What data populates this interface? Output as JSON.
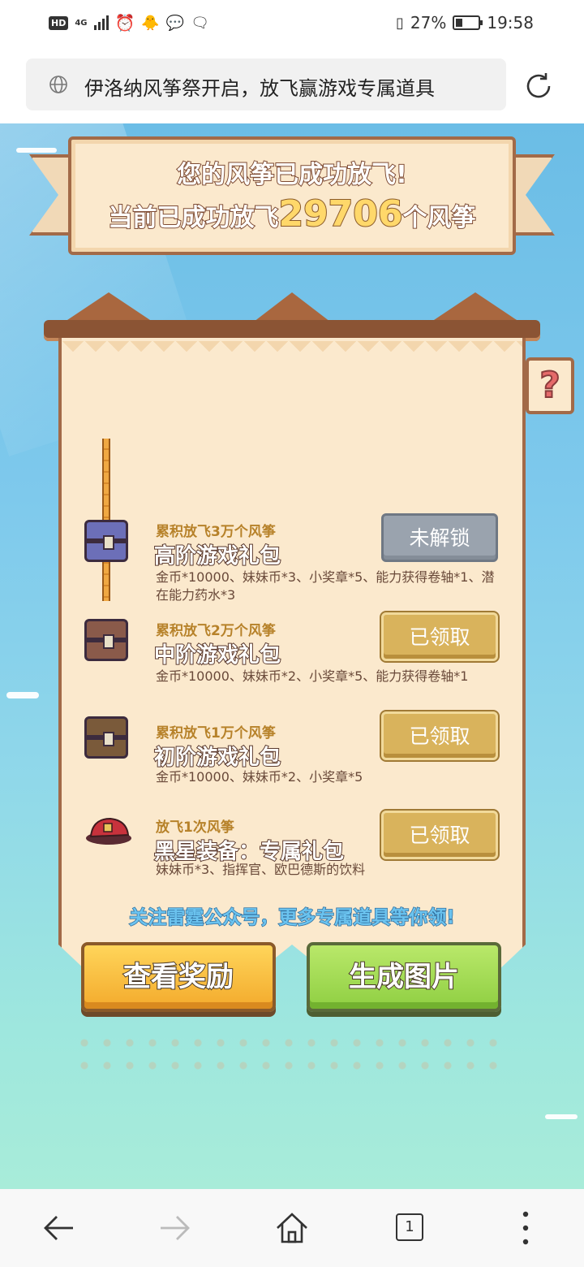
{
  "status": {
    "time": "19:58",
    "battery": "27%",
    "network": "4G",
    "hd": "HD"
  },
  "address": {
    "title": "伊洛纳风筝祭开启，放飞赢游戏专属道具"
  },
  "banner": {
    "line1": "您的风筝已成功放飞!",
    "line2_prefix": "当前已成功放飞",
    "count": "29706",
    "line2_suffix": "个风筝"
  },
  "help": {
    "label": "?"
  },
  "rewards": [
    {
      "req": "累积放飞3万个风筝",
      "name": "高阶游戏礼包",
      "desc": "金币*10000、妹妹币*3、小奖章*5、能力获得卷轴*1、潜在能力药水*3",
      "button": "未解锁",
      "state": "locked"
    },
    {
      "req": "累积放飞2万个风筝",
      "name": "中阶游戏礼包",
      "desc": "金币*10000、妹妹币*2、小奖章*5、能力获得卷轴*1",
      "button": "已领取",
      "state": "claimed"
    },
    {
      "req": "累积放飞1万个风筝",
      "name": "初阶游戏礼包",
      "desc": "金币*10000、妹妹币*2、小奖章*5",
      "button": "已领取",
      "state": "claimed"
    },
    {
      "req": "放飞1次风筝",
      "name": "黑星装备：专属礼包",
      "desc": "妹妹币*3、指挥官、欧巴德斯的饮料",
      "button": "已领取",
      "state": "claimed"
    }
  ],
  "follow_text": "关注雷霆公众号，更多专属道具等你领!",
  "actions": {
    "view": "查看奖励",
    "generate": "生成图片"
  },
  "nav": {
    "tab_count": "1"
  },
  "colors": {
    "sky": "#6bbde6",
    "panel": "#fbe9cd",
    "border": "#a26a48",
    "claimed": "#d9b35c",
    "locked": "#9aa3ae"
  }
}
